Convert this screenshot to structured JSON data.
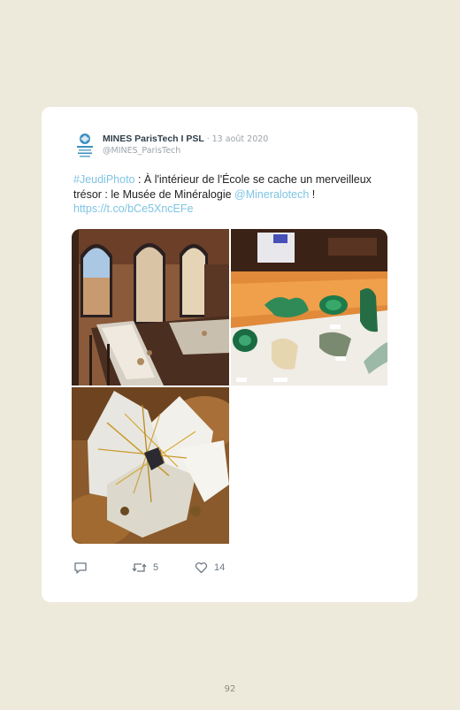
{
  "tweet": {
    "author_name": "MINES ParisTech I PSL",
    "separator": "·",
    "date": "13 août 2020",
    "handle": "@MINES_ParisTech",
    "text": {
      "hashtag": "#JeudiPhoto",
      "part1": " : À l'intérieur de l'École se cache un merveilleux trésor : le Musée de Minéralogie ",
      "mention": "@Mineralotech",
      "part2": " ! ",
      "url": "https://t.co/bCe5XncEFe"
    },
    "photos": [
      {
        "icon": "museum-gallery-photo"
      },
      {
        "icon": "malachite-display-photo"
      },
      {
        "icon": "rutilated-quartz-photo"
      }
    ],
    "actions": {
      "reply_icon": "speech-bubble-icon",
      "retweet_icon": "retweet-icon",
      "retweet_count": "5",
      "like_icon": "heart-icon",
      "like_count": "14"
    }
  },
  "page_number": "92",
  "colors": {
    "page_background": "#eeeadb",
    "card_background": "#ffffff",
    "link": "#7ec4e4",
    "muted": "#9aa4ab"
  }
}
